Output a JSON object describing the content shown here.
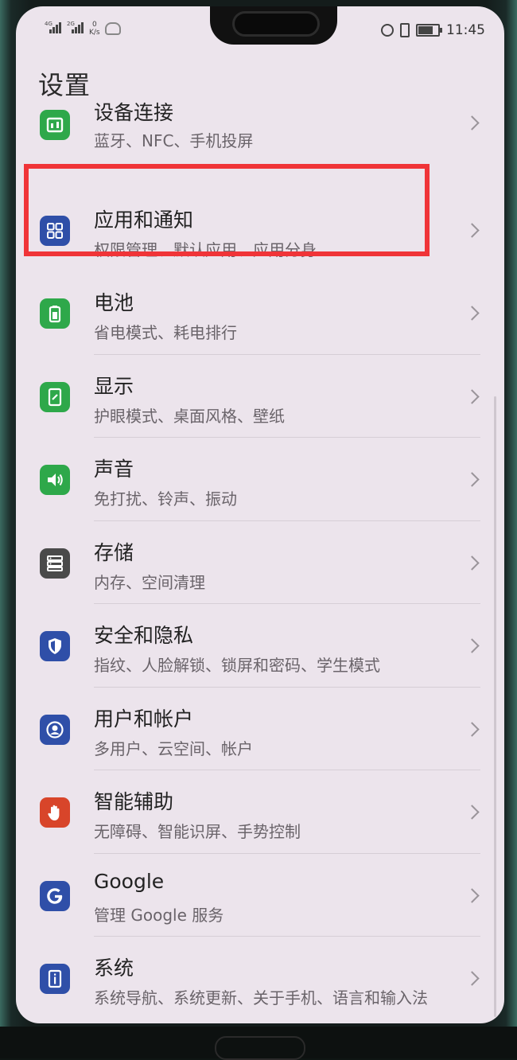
{
  "status_bar": {
    "sim1_tag": "4G",
    "sim2_tag": "2G",
    "speed_value": "0",
    "speed_unit": "K/s",
    "battery_level_percent": 80,
    "time": "11:45"
  },
  "page": {
    "title": "设置"
  },
  "settings": {
    "items": [
      {
        "title": "设备连接",
        "subtitle": "蓝牙、NFC、手机投屏",
        "icon": "device-connection-icon",
        "color": "#2ea84a"
      },
      {
        "title": "应用和通知",
        "subtitle": "权限管理、默认应用、应用分身",
        "icon": "apps-grid-icon",
        "color": "#2f4fa8"
      },
      {
        "title": "电池",
        "subtitle": "省电模式、耗电排行",
        "icon": "battery-icon",
        "color": "#2ea84a"
      },
      {
        "title": "显示",
        "subtitle": "护眼模式、桌面风格、壁纸",
        "icon": "display-icon",
        "color": "#2ea84a"
      },
      {
        "title": "声音",
        "subtitle": "免打扰、铃声、振动",
        "icon": "sound-icon",
        "color": "#2ea84a"
      },
      {
        "title": "存储",
        "subtitle": "内存、空间清理",
        "icon": "storage-icon",
        "color": "#4a4a4a"
      },
      {
        "title": "安全和隐私",
        "subtitle": "指纹、人脸解锁、锁屏和密码、学生模式",
        "icon": "shield-icon",
        "color": "#2f4fa8"
      },
      {
        "title": "用户和帐户",
        "subtitle": "多用户、云空间、帐户",
        "icon": "user-icon",
        "color": "#2f4fa8"
      },
      {
        "title": "智能辅助",
        "subtitle": "无障碍、智能识屏、手势控制",
        "icon": "hand-icon",
        "color": "#d8452a"
      },
      {
        "title": "Google",
        "subtitle": "管理 Google 服务",
        "icon": "google-icon",
        "color": "#2f4fa8"
      },
      {
        "title": "系统",
        "subtitle": "系统导航、系统更新、关于手机、语言和输入法",
        "icon": "system-info-icon",
        "color": "#2f4fa8"
      }
    ]
  },
  "annotation": {
    "highlight_color": "#f03438",
    "highlighted_item": "应用和通知"
  }
}
